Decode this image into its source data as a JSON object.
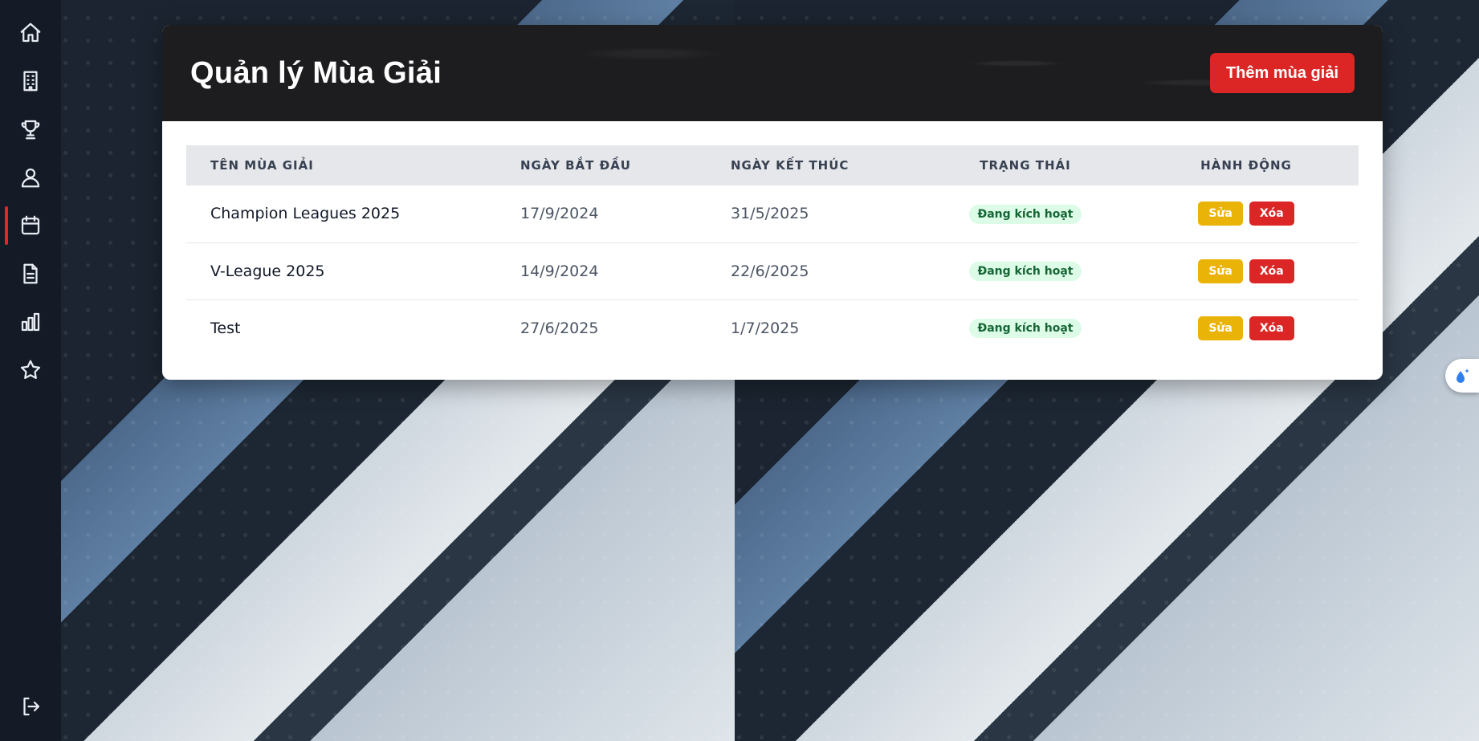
{
  "sidebar": {
    "items": [
      {
        "icon": "home-icon"
      },
      {
        "icon": "building-icon"
      },
      {
        "icon": "trophy-icon"
      },
      {
        "icon": "user-icon"
      },
      {
        "icon": "calendar-icon",
        "active": true
      },
      {
        "icon": "document-icon"
      },
      {
        "icon": "bar-chart-icon"
      },
      {
        "icon": "star-icon"
      }
    ],
    "logout_icon": "logout-icon"
  },
  "header": {
    "title": "Quản lý Mùa Giải",
    "add_label": "Thêm mùa giải"
  },
  "table": {
    "columns": [
      "TÊN MÙA GIẢI",
      "NGÀY BẮT ĐẦU",
      "NGÀY KẾT THÚC",
      "TRẠNG THÁI",
      "HÀNH ĐỘNG"
    ],
    "rows": [
      {
        "name": "Champion Leagues 2025",
        "start": "17/9/2024",
        "end": "31/5/2025",
        "status": "Đang kích hoạt",
        "edit": "Sửa",
        "delete": "Xóa"
      },
      {
        "name": "V-League 2025",
        "start": "14/9/2024",
        "end": "22/6/2025",
        "status": "Đang kích hoạt",
        "edit": "Sửa",
        "delete": "Xóa"
      },
      {
        "name": "Test",
        "start": "27/6/2025",
        "end": "1/7/2025",
        "status": "Đang kích hoạt",
        "edit": "Sửa",
        "delete": "Xóa"
      }
    ]
  },
  "colors": {
    "accent": "#dc2626",
    "edit": "#eab308",
    "status_bg": "#dcfce7",
    "status_text": "#166534",
    "sidebar_bg": "#141b27"
  }
}
